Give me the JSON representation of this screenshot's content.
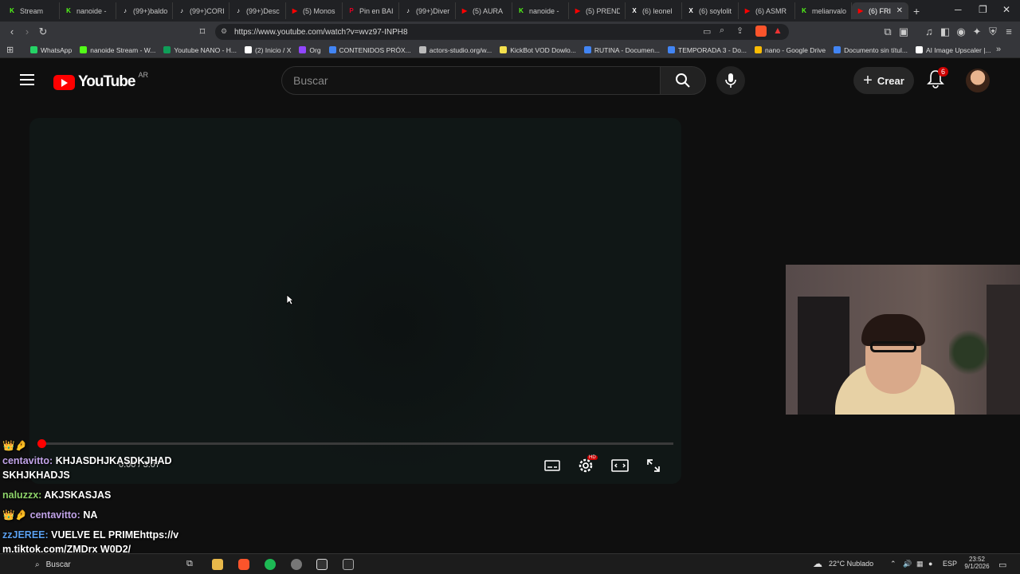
{
  "browser": {
    "tabs": [
      {
        "label": "Stream",
        "icon": "kick",
        "color": "#53fc18"
      },
      {
        "label": "nanoide -",
        "icon": "kick",
        "color": "#53fc18"
      },
      {
        "label": "(99+)baldo",
        "icon": "tiktok",
        "color": "#ffffff"
      },
      {
        "label": "(99+)CORI",
        "icon": "tiktok",
        "color": "#ffffff"
      },
      {
        "label": "(99+)Desc",
        "icon": "tiktok",
        "color": "#ffffff"
      },
      {
        "label": "(5) Monos",
        "icon": "youtube",
        "color": "#ff0000"
      },
      {
        "label": "Pin en BAI",
        "icon": "pinterest",
        "color": "#e60023"
      },
      {
        "label": "(99+)Diver",
        "icon": "tiktok",
        "color": "#ffffff"
      },
      {
        "label": "(5) AURA",
        "icon": "youtube",
        "color": "#ff0000"
      },
      {
        "label": "nanoide -",
        "icon": "kick",
        "color": "#53fc18"
      },
      {
        "label": "(5) PREND",
        "icon": "youtube",
        "color": "#ff0000"
      },
      {
        "label": "(6) leonel",
        "icon": "x",
        "color": "#ffffff"
      },
      {
        "label": "(6) soylolit",
        "icon": "x",
        "color": "#ffffff"
      },
      {
        "label": "(6) ASMR",
        "icon": "youtube",
        "color": "#ff0000"
      },
      {
        "label": "melianvalo",
        "icon": "kick",
        "color": "#53fc18"
      },
      {
        "label": "(6) FRI",
        "icon": "youtube",
        "color": "#ff0000",
        "active": true
      }
    ],
    "url": "https://www.youtube.com/watch?v=wvz97-INPH8",
    "bookmarks": [
      {
        "label": "WhatsApp",
        "color": "#25d366"
      },
      {
        "label": "nanoide Stream - W...",
        "color": "#53fc18"
      },
      {
        "label": "Youtube NANO - H...",
        "color": "#0f9d58"
      },
      {
        "label": "(2) Inicio / X",
        "color": "#ffffff"
      },
      {
        "label": "Org",
        "color": "#9146ff"
      },
      {
        "label": "CONTENIDOS PRÓX...",
        "color": "#4285f4"
      },
      {
        "label": "actors-studio.org/w...",
        "color": "#bbbbbb"
      },
      {
        "label": "KickBot VOD Dowlo...",
        "color": "#f4e04d"
      },
      {
        "label": "RUTINA - Documen...",
        "color": "#4285f4"
      },
      {
        "label": "TEMPORADA 3 - Do...",
        "color": "#4285f4"
      },
      {
        "label": "nano - Google Drive",
        "color": "#fbbc04"
      },
      {
        "label": "Documento sin títul...",
        "color": "#4285f4"
      },
      {
        "label": "AI Image Upscaler |...",
        "color": "#ffffff"
      }
    ]
  },
  "youtube": {
    "logo_text": "YouTube",
    "country": "AR",
    "search_placeholder": "Buscar",
    "create_label": "Crear",
    "notifications": "6"
  },
  "player": {
    "time": "0:00 / 3:07",
    "progress": 0
  },
  "chat": [
    {
      "badges": "👑🤌",
      "user": "",
      "text": ""
    },
    {
      "badges": "",
      "user": "centavitto:",
      "text": "KHJASDHJKASDKJHAD SKHJKHADJS"
    },
    {
      "badges": "",
      "user": "naluzzx:",
      "text": "AKJSKASJAS"
    },
    {
      "badges": "👑🤌",
      "user": "centavitto:",
      "text": "NA"
    },
    {
      "badges": "",
      "user": "zzJEREE:",
      "text": "VUELVE EL PRIMEhttps://vm.tiktok.com/ZMDrx W0D2/"
    }
  ],
  "taskbar": {
    "search": "Buscar",
    "weather": "22°C  Nublado",
    "lang": "ESP",
    "time": "23:52",
    "date": "9/1/2026"
  }
}
